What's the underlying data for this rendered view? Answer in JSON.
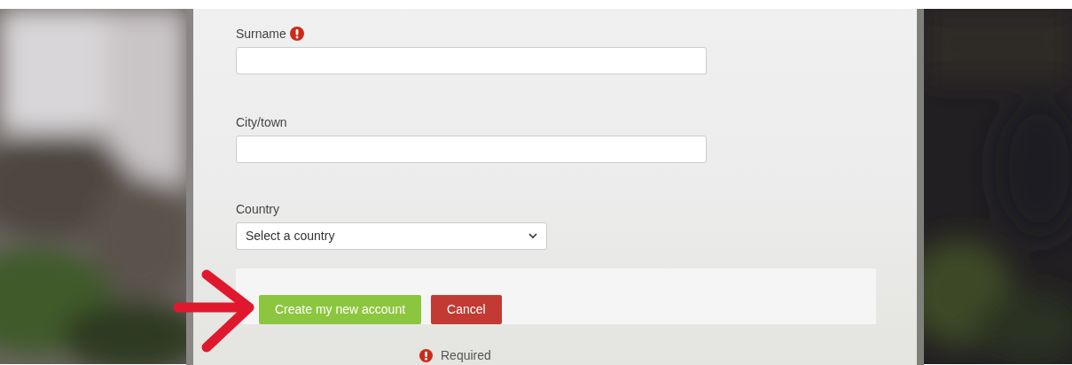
{
  "fields": [
    {
      "kind": "text",
      "label": "Surname",
      "required": true
    },
    {
      "kind": "text",
      "label": "City/town",
      "required": false
    },
    {
      "kind": "select",
      "label": "Country",
      "value": "Select a country",
      "required": false
    }
  ],
  "buttons": [
    {
      "kind": "primary",
      "label": "Create my new account"
    },
    {
      "kind": "danger",
      "label": "Cancel"
    }
  ],
  "legend": {
    "label": "Required"
  }
}
